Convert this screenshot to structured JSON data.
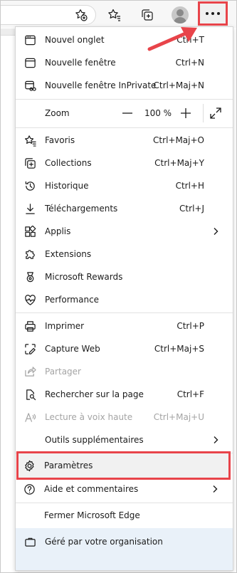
{
  "toolbar": {
    "icons": [
      "add-favorite-icon",
      "favorites-icon",
      "collections-icon",
      "profile-avatar",
      "more-icon"
    ]
  },
  "menu": {
    "new_tab": {
      "label": "Nouvel onglet",
      "shortcut": "Ctrl+T"
    },
    "new_window": {
      "label": "Nouvelle fenêtre",
      "shortcut": "Ctrl+N"
    },
    "new_private": {
      "label": "Nouvelle fenêtre InPrivate",
      "shortcut": "Ctrl+Maj+N"
    },
    "zoom": {
      "label": "Zoom",
      "value": "100 %"
    },
    "favorites": {
      "label": "Favoris",
      "shortcut": "Ctrl+Maj+O"
    },
    "collections": {
      "label": "Collections",
      "shortcut": "Ctrl+Maj+Y"
    },
    "history": {
      "label": "Historique",
      "shortcut": "Ctrl+H"
    },
    "downloads": {
      "label": "Téléchargements",
      "shortcut": "Ctrl+J"
    },
    "apps": {
      "label": "Applis"
    },
    "extensions": {
      "label": "Extensions"
    },
    "rewards": {
      "label": "Microsoft Rewards"
    },
    "performance": {
      "label": "Performance"
    },
    "print": {
      "label": "Imprimer",
      "shortcut": "Ctrl+P"
    },
    "web_capture": {
      "label": "Capture Web",
      "shortcut": "Ctrl+Maj+S"
    },
    "share": {
      "label": "Partager"
    },
    "find": {
      "label": "Rechercher sur la page",
      "shortcut": "Ctrl+F"
    },
    "read_aloud": {
      "label": "Lecture à voix haute",
      "shortcut": "Ctrl+Maj+U"
    },
    "more_tools": {
      "label": "Outils supplémentaires"
    },
    "settings": {
      "label": "Paramètres"
    },
    "help": {
      "label": "Aide et commentaires"
    },
    "close": {
      "label": "Fermer Microsoft Edge"
    },
    "managed": {
      "label": "Géré par votre organisation"
    }
  },
  "colors": {
    "highlight_border": "#e8444a",
    "managed_bg": "#e9f1f9",
    "disabled_text": "#a4a4a4"
  }
}
